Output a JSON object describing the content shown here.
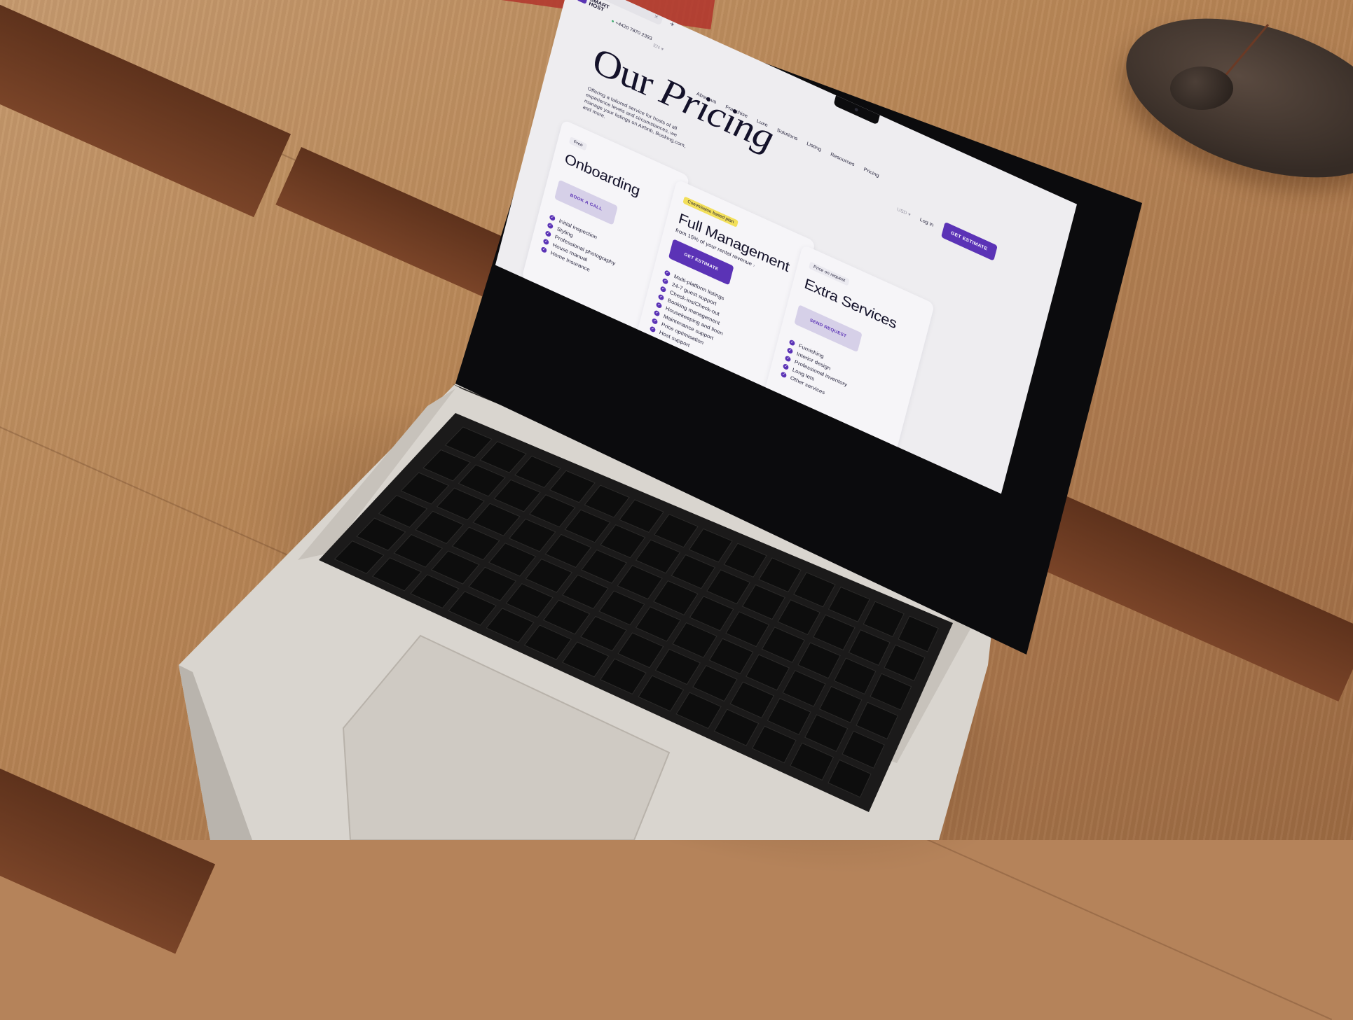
{
  "colors": {
    "brand_purple": "#5b33b6",
    "secondary_button": "#d6d0e8",
    "plan_tag_yellow": "#f2df5a",
    "page_background": "#eeedf0"
  },
  "browser": {
    "tab_close": "×",
    "tab_add": "+"
  },
  "site": {
    "logo_text": "SMART HOST",
    "logo_mark": "SH",
    "phone": "+4420 7870 2393",
    "language": "EN ▾",
    "currency": "USD ▾",
    "login": "Log in",
    "cta": "GET ESTIMATE"
  },
  "nav": [
    {
      "label": "About us"
    },
    {
      "label": "Franchise"
    },
    {
      "label": "Luxe"
    },
    {
      "label": "Solutions"
    },
    {
      "label": "Listing"
    },
    {
      "label": "Resources"
    },
    {
      "label": "Pricing"
    }
  ],
  "hero": {
    "title_plain": "Our ",
    "title_italic": "Pricing",
    "subtitle": "Offering a tailored service for hosts of all experience levels and circumstances, we manage your listings on Airbnb, Booking.com, and more."
  },
  "plans": [
    {
      "tag": "Free",
      "title": "Onboarding",
      "subtitle": "",
      "button": "BOOK A CALL",
      "features": [
        "Initial inspection",
        "Styling",
        "Professional photography",
        "House manual",
        "Home Insurance"
      ]
    },
    {
      "tag": "Commission based plan",
      "title": "Full Management",
      "subtitle": "from 15% of your rental revenue",
      "button": "GET ESTIMATE",
      "features": [
        "Multi-platform listings",
        "24-7 guest support",
        "Check-ins/Check-out",
        "Booking management",
        "Housekeeping and linen",
        "Maintenance support",
        "Price optimisation",
        "Host support"
      ]
    },
    {
      "tag": "Price on request",
      "title": "Extra Services",
      "subtitle": "",
      "button": "SEND REQUEST",
      "features": [
        "Furnishing",
        "Interior design",
        "Professional inventory",
        "Long lets",
        "Other services"
      ]
    }
  ],
  "icons": {
    "check": "check-circle-icon",
    "camera": "camera-icon",
    "logo": "logo-icon"
  }
}
